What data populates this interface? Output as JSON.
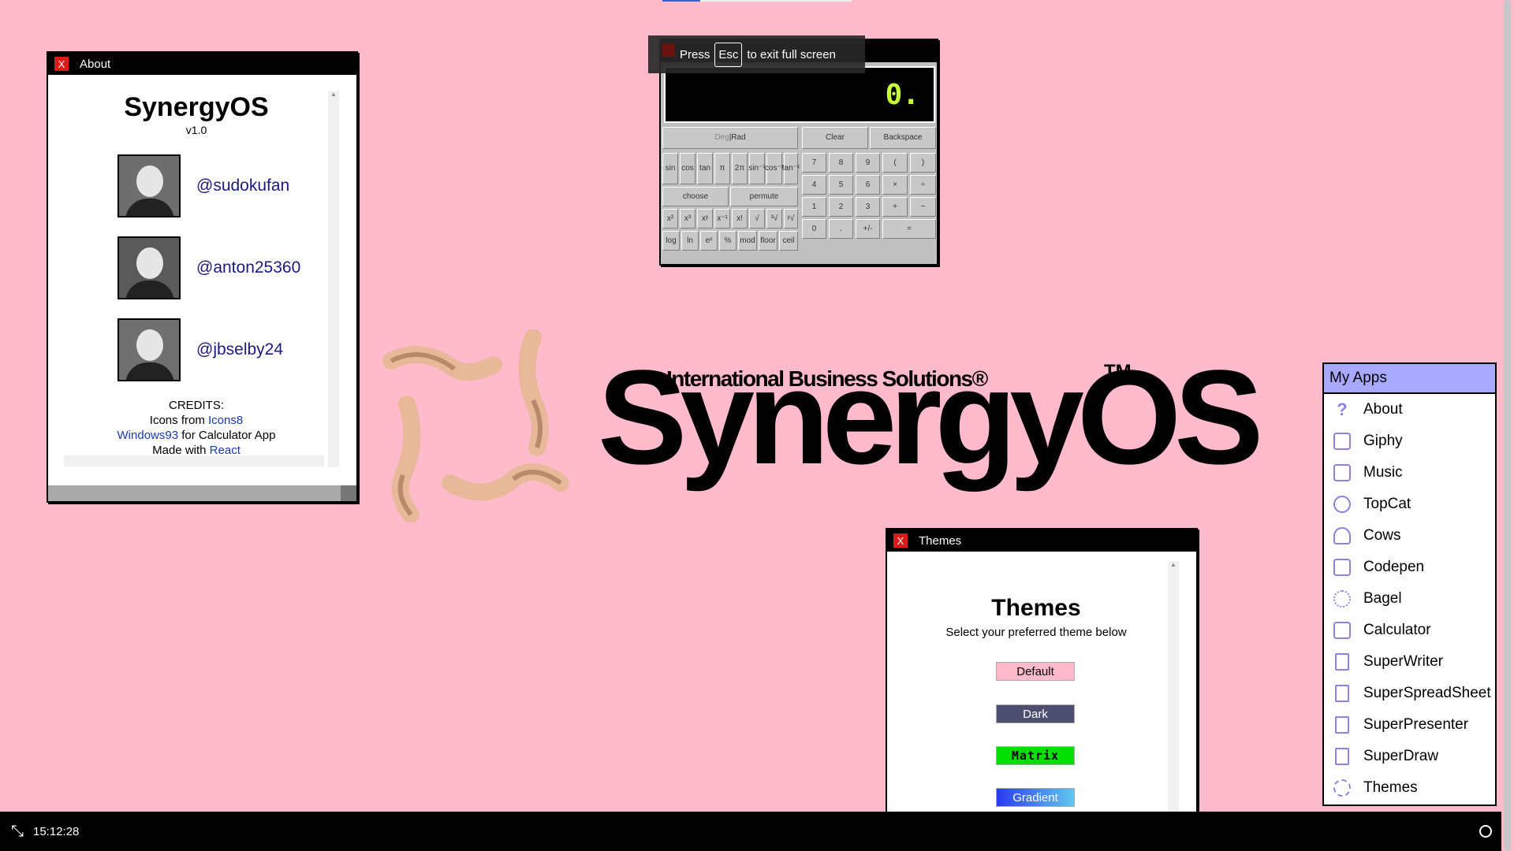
{
  "about": {
    "window_title": "About",
    "close": "X",
    "app_name": "SynergyOS",
    "version": "v1.0",
    "people": [
      {
        "handle": "@sudokufan"
      },
      {
        "handle": "@anton25360"
      },
      {
        "handle": "@jbselby24"
      }
    ],
    "credits": {
      "heading": "CREDITS:",
      "line1_prefix": "Icons from ",
      "line1_link": "Icons8",
      "line2_link": "Windows93",
      "line2_suffix": " for Calculator App",
      "line3_prefix": "Made with ",
      "line3_link": "React"
    }
  },
  "calculator": {
    "display": "0.",
    "mode": {
      "deg": "Deg",
      "sep": " | ",
      "rad": "Rad"
    },
    "clear": "Clear",
    "backspace": "Backspace",
    "sci_row1": [
      "sin",
      "cos",
      "tan",
      "π",
      "2π",
      "sin⁻¹",
      "cos⁻¹",
      "tan⁻¹"
    ],
    "choose": "choose",
    "permute": "permute",
    "sci_row3": [
      "x²",
      "x³",
      "xʸ",
      "x⁻¹",
      "x!",
      "√",
      "³√",
      "ʸ√"
    ],
    "sci_row4": [
      "log",
      "ln",
      "eˣ",
      "%",
      "mod",
      "floor",
      "ceil"
    ],
    "num_rows": [
      [
        "7",
        "8",
        "9",
        "(",
        ")"
      ],
      [
        "4",
        "5",
        "6",
        "×",
        "÷"
      ],
      [
        "1",
        "2",
        "3",
        "+",
        "−"
      ],
      [
        "0",
        ".",
        "+/-",
        "="
      ]
    ]
  },
  "toast": {
    "press": "Press",
    "key": "Esc",
    "rest": "to exit full screen"
  },
  "logo": {
    "company": "International Business Solutions®",
    "product": "SynergyOS",
    "tm": "TM"
  },
  "themes": {
    "window_title": "Themes",
    "close": "X",
    "heading": "Themes",
    "subtitle": "Select your preferred theme below",
    "options": [
      "Default",
      "Dark",
      "Matrix",
      "Gradient"
    ]
  },
  "apps": {
    "heading": "My Apps",
    "items": [
      {
        "label": "About",
        "icon": "question-icon"
      },
      {
        "label": "Giphy",
        "icon": "giphy-icon"
      },
      {
        "label": "Music",
        "icon": "music-icon"
      },
      {
        "label": "TopCat",
        "icon": "cat-icon"
      },
      {
        "label": "Cows",
        "icon": "cow-icon"
      },
      {
        "label": "Codepen",
        "icon": "codepen-icon"
      },
      {
        "label": "Bagel",
        "icon": "bagel-icon"
      },
      {
        "label": "Calculator",
        "icon": "calculator-icon"
      },
      {
        "label": "SuperWriter",
        "icon": "document-icon"
      },
      {
        "label": "SuperSpreadSheet",
        "icon": "document-icon"
      },
      {
        "label": "SuperPresenter",
        "icon": "document-icon"
      },
      {
        "label": "SuperDraw",
        "icon": "document-icon"
      },
      {
        "label": "Themes",
        "icon": "gear-icon"
      }
    ]
  },
  "taskbar": {
    "time": "15:12:28",
    "fullscreen_icon": "exit-fullscreen-icon"
  },
  "colors": {
    "background": "#ffbbcc",
    "apps_header": "#a8a8ff",
    "close": "#e01818",
    "calc_display_text": "#c8ff3c"
  }
}
